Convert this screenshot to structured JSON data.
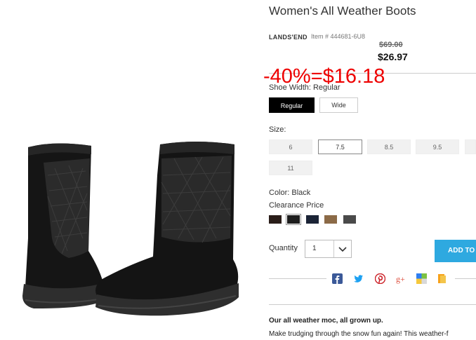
{
  "product": {
    "title": "Women's All Weather Boots",
    "brand": "LANDS'END",
    "item_number": "Item # 444681-6U8",
    "original_price": "$69.00",
    "sale_price": "$26.97",
    "promo_overlay": "-40%=$16.18"
  },
  "shoe_width": {
    "label": "Shoe Width: Regular",
    "options": [
      "Regular",
      "Wide"
    ],
    "selected": "Regular"
  },
  "size": {
    "label": "Size:",
    "options": [
      "6",
      "7.5",
      "8.5",
      "9.5",
      "11"
    ],
    "selected": "7.5"
  },
  "color": {
    "label": "Color: Black",
    "clearance_label": "Clearance Price",
    "swatches": [
      {
        "name": "brown-black",
        "hex": "#2a1d19"
      },
      {
        "name": "black",
        "hex": "#1e1e1e"
      },
      {
        "name": "navy",
        "hex": "#1b2436"
      },
      {
        "name": "tan",
        "hex": "#8b6a47"
      },
      {
        "name": "gray",
        "hex": "#4a4a4a"
      }
    ],
    "selected_index": 1
  },
  "quantity": {
    "label": "Quantity",
    "value": "1"
  },
  "cart": {
    "add_label": "ADD TO"
  },
  "share": {
    "icons": [
      "facebook-icon",
      "twitter-icon",
      "pinterest-icon",
      "google-plus-icon",
      "delicious-icon",
      "bookmark-icon"
    ]
  },
  "description": {
    "headline": "Our all weather moc, all grown up.",
    "body": "Make trudging through the snow fun again! This weather-f"
  },
  "colors": {
    "accent": "#2ea9e0",
    "promo": "#ee0000"
  }
}
